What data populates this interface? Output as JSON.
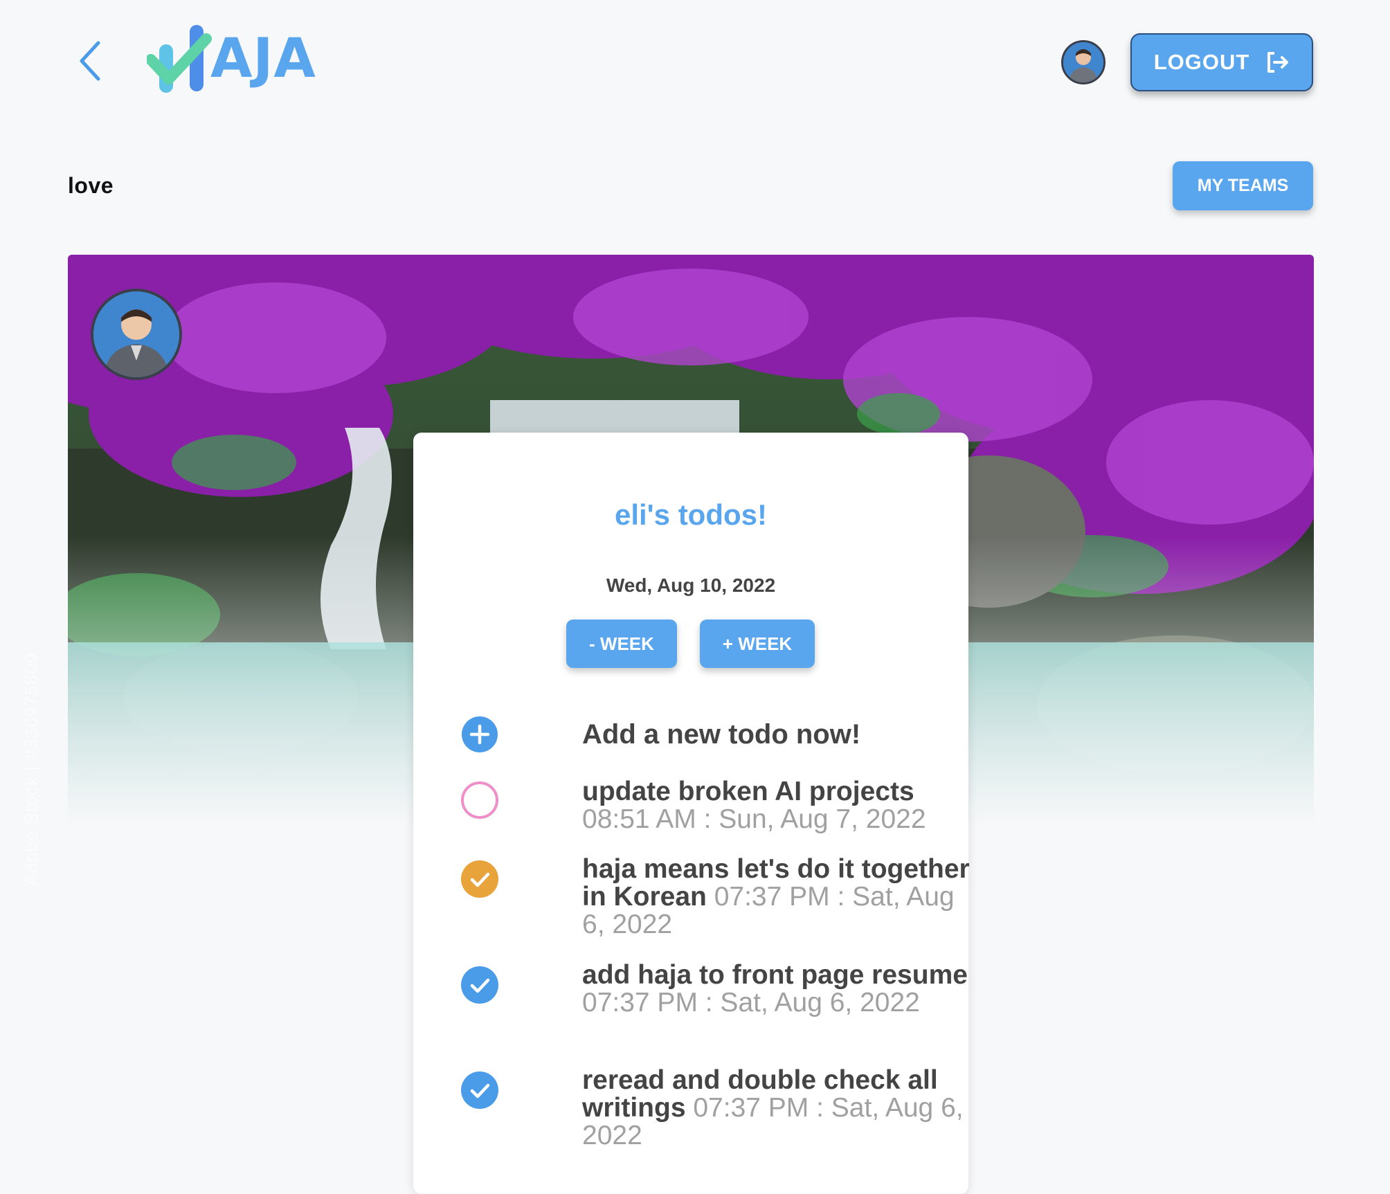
{
  "header": {
    "logo_text": "AJA",
    "logout_label": "LOGOUT"
  },
  "team": {
    "name": "love",
    "my_teams_label": "MY TEAMS"
  },
  "hero": {
    "watermark": "Adobe Stock | #336975809"
  },
  "card": {
    "title": "eli's todos!",
    "date": "Wed, Aug 10, 2022",
    "minus_week_label": "- WEEK",
    "plus_week_label": "+ WEEK",
    "add_label": "Add a new todo now!",
    "todos": [
      {
        "text": "update broken AI projects",
        "time": "08:51 AM : Sun, Aug 7, 2022",
        "status": "open",
        "color": "#ee8fc7"
      },
      {
        "text": "haja means let's do it together in Korean",
        "time": "07:37 PM : Sat, Aug 6, 2022",
        "status": "done",
        "color": "#e8a33a"
      },
      {
        "text": "add haja to front page resume",
        "time": "07:37 PM : Sat, Aug 6, 2022",
        "status": "done",
        "color": "#4a9be8"
      },
      {
        "text": "reread and double check all writings",
        "time": "07:37 PM : Sat, Aug 6, 2022",
        "status": "done",
        "color": "#4a9be8"
      }
    ]
  },
  "colors": {
    "accent": "#5aa6ee",
    "page_bg": "#f7f8fa"
  },
  "icons": [
    "chevron-left-icon",
    "logout-icon",
    "plus-circle-icon",
    "empty-circle-icon",
    "check-circle-icon"
  ]
}
